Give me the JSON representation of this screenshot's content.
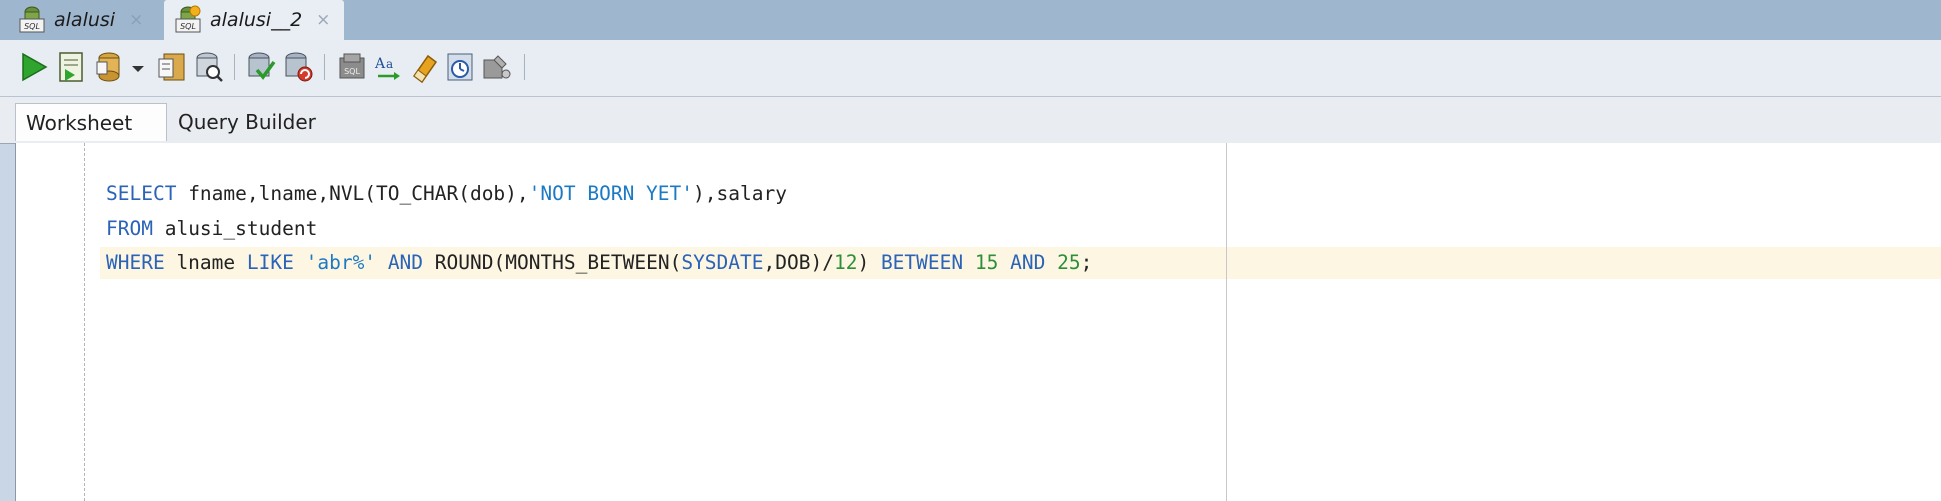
{
  "tabs": [
    {
      "label": "alalusi",
      "close": "×",
      "active": false,
      "icon": "sql-connection-icon"
    },
    {
      "label": "alalusi__2",
      "close": "×",
      "active": true,
      "icon": "sql-connection-new-icon"
    }
  ],
  "toolbar": {
    "icons": [
      "run-statement-icon",
      "run-script-icon",
      "commit-icon",
      "dropdown-arrow-icon",
      "explain-plan-icon",
      "autotrace-icon",
      "commit-transaction-icon",
      "rollback-icon",
      "sql-tuning-icon",
      "format-case-icon",
      "clear-eraser-icon",
      "history-icon",
      "monitor-icon"
    ]
  },
  "subtabs": {
    "worksheet": "Worksheet",
    "query_builder": "Query Builder"
  },
  "editor": {
    "line1": {
      "kw_select": "SELECT",
      "p1": " fname,lname,NVL(TO_CHAR(dob),",
      "str_not_born": "'NOT BORN YET'",
      "p2": "),salary"
    },
    "line2": {
      "kw_from": "FROM",
      "p1": " alusi_student"
    },
    "line3": {
      "kw_where": "WHERE",
      "p1": " lname ",
      "kw_like": "LIKE",
      "sp1": " ",
      "str_abr": "'abr%'",
      "sp2": " ",
      "kw_and1": "AND",
      "p2": " ROUND(MONTHS_BETWEEN(",
      "kw_sysdate": "SYSDATE",
      "p3": ",DOB)/",
      "num_12": "12",
      "p4": ") ",
      "kw_between": "BETWEEN",
      "sp3": " ",
      "num_15": "15",
      "sp4": " ",
      "kw_and2": "AND",
      "sp5": " ",
      "num_25": "25",
      "p5": ";"
    }
  },
  "colors": {
    "keyword": "#2a63b8",
    "string": "#1c7ac4",
    "number": "#2e8f39",
    "current_line": "#fdf6e3"
  }
}
